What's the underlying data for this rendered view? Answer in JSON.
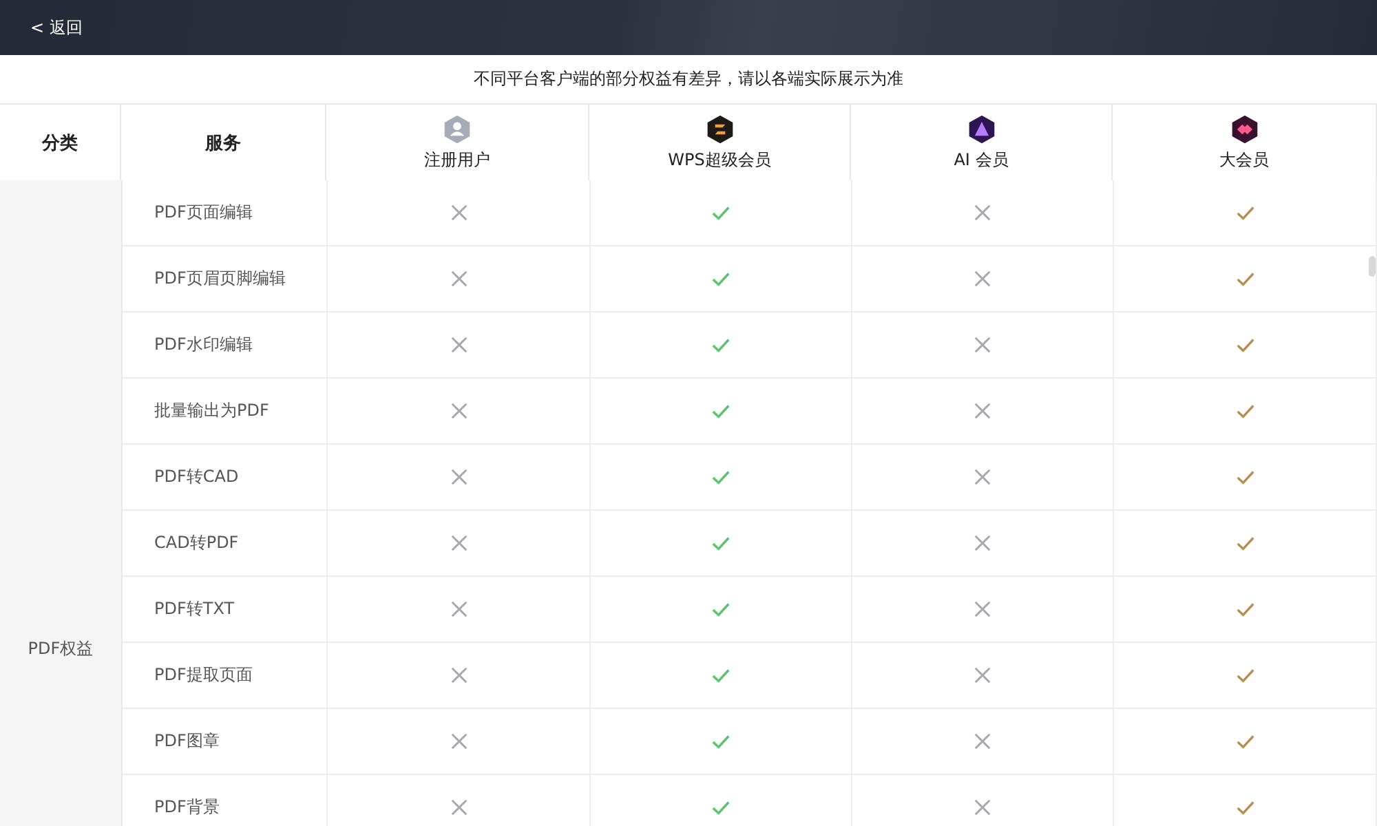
{
  "top_bar": {
    "back": "< 返回"
  },
  "notice": "不同平台客户端的部分权益有差异，请以各端实际展示为准",
  "table": {
    "category_header": "分类",
    "service_header": "服务",
    "tiers": [
      {
        "name": "注册用户",
        "kind": "user"
      },
      {
        "name": "WPS超级会员",
        "kind": "wps"
      },
      {
        "name": "AI 会员",
        "kind": "ai"
      },
      {
        "name": "大会员",
        "kind": "big"
      }
    ],
    "category": "PDF权益",
    "rows": [
      {
        "service": "PDF页面编辑",
        "included": [
          false,
          true,
          false,
          true
        ]
      },
      {
        "service": "PDF页眉页脚编辑",
        "included": [
          false,
          true,
          false,
          true
        ]
      },
      {
        "service": "PDF水印编辑",
        "included": [
          false,
          true,
          false,
          true
        ]
      },
      {
        "service": "批量输出为PDF",
        "included": [
          false,
          true,
          false,
          true
        ]
      },
      {
        "service": "PDF转CAD",
        "included": [
          false,
          true,
          false,
          true
        ]
      },
      {
        "service": "CAD转PDF",
        "included": [
          false,
          true,
          false,
          true
        ]
      },
      {
        "service": "PDF转TXT",
        "included": [
          false,
          true,
          false,
          true
        ]
      },
      {
        "service": "PDF提取页面",
        "included": [
          false,
          true,
          false,
          true
        ]
      },
      {
        "service": "PDF图章",
        "included": [
          false,
          true,
          false,
          true
        ]
      },
      {
        "service": "PDF背景",
        "included": [
          false,
          true,
          false,
          true
        ]
      }
    ]
  }
}
